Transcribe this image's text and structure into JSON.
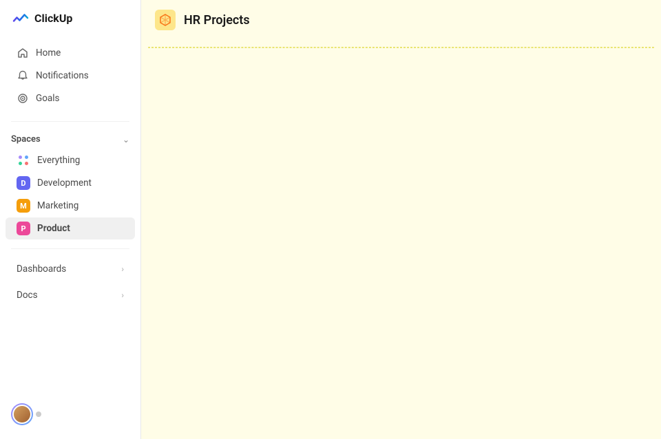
{
  "logo": {
    "text": "ClickUp"
  },
  "nav": {
    "home_label": "Home",
    "notifications_label": "Notifications",
    "goals_label": "Goals"
  },
  "spaces": {
    "section_label": "Spaces",
    "items": [
      {
        "id": "everything",
        "label": "Everything",
        "type": "everything"
      },
      {
        "id": "development",
        "label": "Development",
        "type": "letter",
        "letter": "D",
        "color": "#6366f1"
      },
      {
        "id": "marketing",
        "label": "Marketing",
        "type": "letter",
        "letter": "M",
        "color": "#f59e0b"
      },
      {
        "id": "product",
        "label": "Product",
        "type": "letter",
        "letter": "P",
        "color": "#ec4899",
        "active": true,
        "bold": true
      }
    ]
  },
  "sections": [
    {
      "id": "dashboards",
      "label": "Dashboards"
    },
    {
      "id": "docs",
      "label": "Docs"
    }
  ],
  "page": {
    "title": "HR Projects",
    "icon": "cube-icon"
  }
}
